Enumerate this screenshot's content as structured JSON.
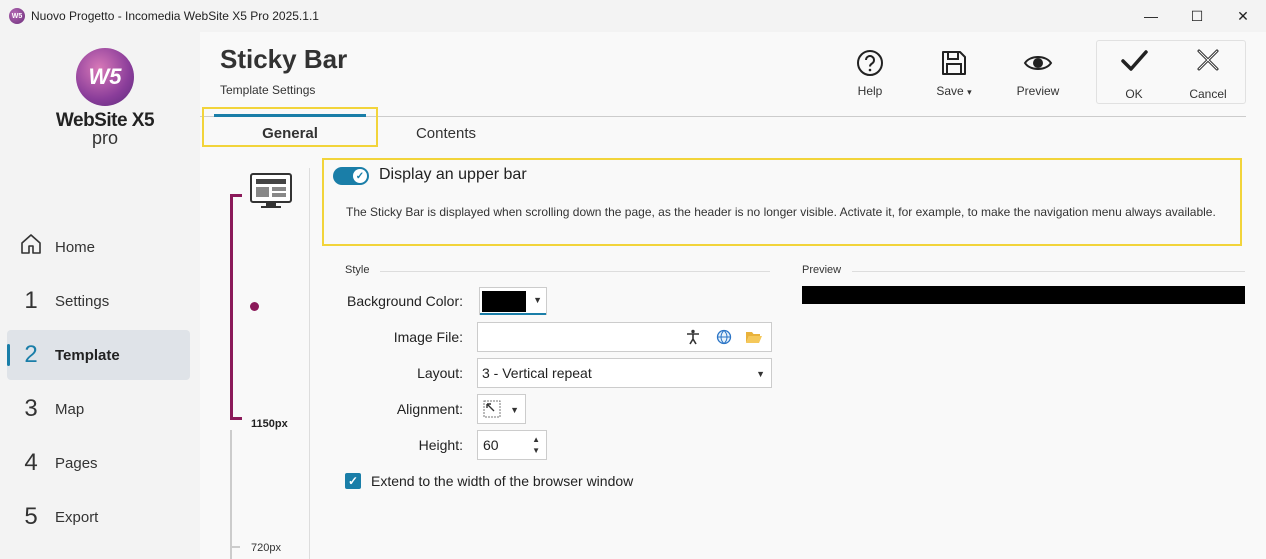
{
  "window": {
    "title": "Nuovo Progetto - Incomedia WebSite X5 Pro 2025.1.1",
    "minimize": "—",
    "maximize": "☐",
    "close": "✕"
  },
  "logo": {
    "mark": "W5",
    "name": "WebSite X5",
    "edition": "pro"
  },
  "sidebar": {
    "items": [
      {
        "num": "",
        "label": "Home",
        "icon": "home-icon"
      },
      {
        "num": "1",
        "label": "Settings"
      },
      {
        "num": "2",
        "label": "Template",
        "active": true
      },
      {
        "num": "3",
        "label": "Map"
      },
      {
        "num": "4",
        "label": "Pages"
      },
      {
        "num": "5",
        "label": "Export"
      }
    ]
  },
  "header": {
    "title": "Sticky Bar",
    "subtitle": "Template Settings"
  },
  "toolbar": {
    "help": "Help",
    "save": "Save",
    "save_arrow": "▾",
    "preview": "Preview",
    "ok": "OK",
    "cancel": "Cancel"
  },
  "tabs": [
    {
      "label": "General",
      "active": true
    },
    {
      "label": "Contents",
      "active": false
    }
  ],
  "ruler": {
    "label_1": "1150px",
    "label_2": "720px"
  },
  "upper_bar": {
    "toggle_label": "Display an upper bar",
    "enabled": true,
    "description": "The Sticky Bar is displayed when scrolling down the page, as the header is no longer visible. Activate it, for example, to make the navigation menu always available."
  },
  "style": {
    "section_label": "Style",
    "background_color_label": "Background Color:",
    "background_color": "#000000",
    "image_file_label": "Image File:",
    "image_file_value": "",
    "layout_label": "Layout:",
    "layout_value": "3 - Vertical repeat",
    "alignment_label": "Alignment:",
    "height_label": "Height:",
    "height_value": "60",
    "extend_label": "Extend to the width of the browser window",
    "extend_checked": true
  },
  "preview": {
    "section_label": "Preview",
    "bar_color": "#000000"
  },
  "colors": {
    "accent": "#1a7ea8",
    "ruler": "#8b1a5a",
    "highlight": "#f2d43b"
  }
}
